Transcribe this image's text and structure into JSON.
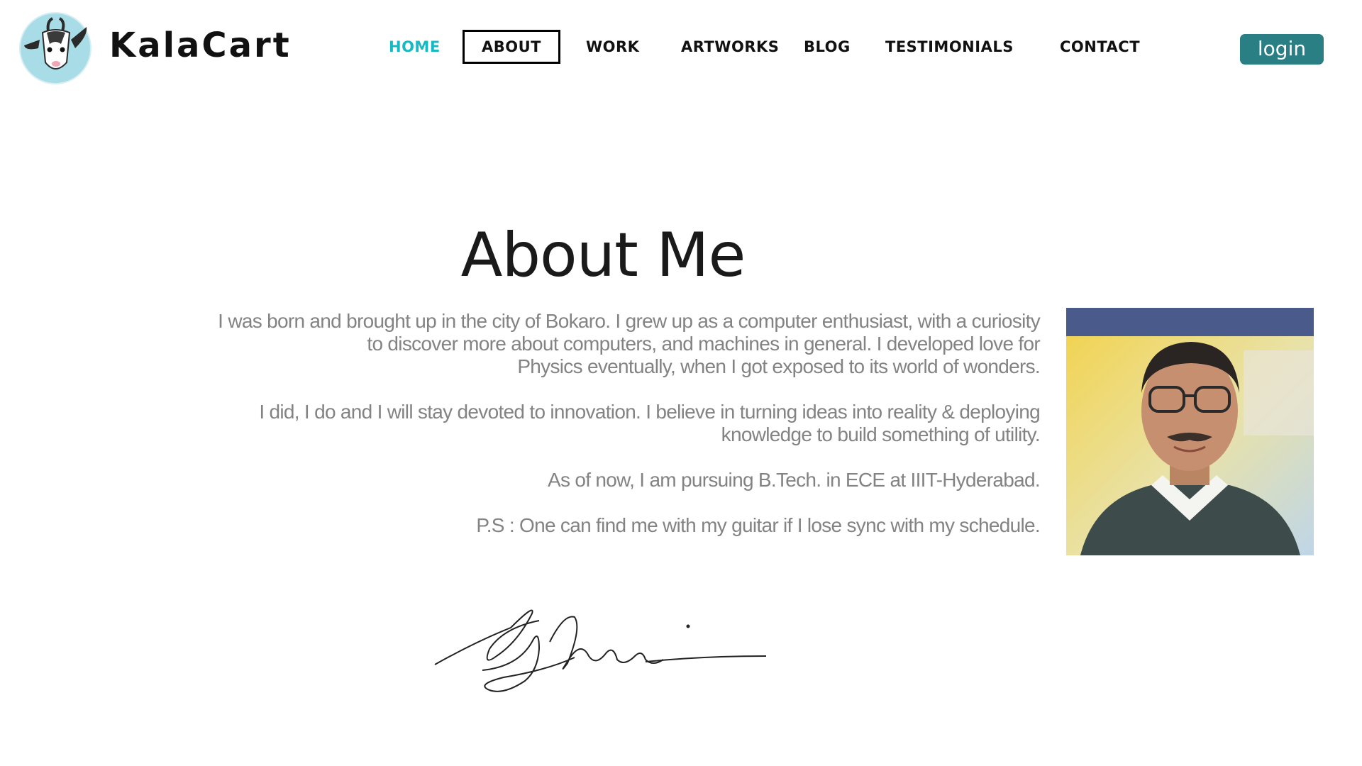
{
  "brand": {
    "name": "KalaCart"
  },
  "nav": {
    "items": [
      {
        "label": "HOME"
      },
      {
        "label": "ABOUT"
      },
      {
        "label": "WORK"
      },
      {
        "label": "ARTWORKS"
      },
      {
        "label": "BLOG"
      },
      {
        "label": "TESTIMONIALS"
      },
      {
        "label": "CONTACT"
      }
    ],
    "login_label": "login"
  },
  "about": {
    "title": "About Me",
    "paragraphs": [
      {
        "lines": [
          "I was born and brought up in the city of Bokaro. I grew up as a computer enthusiast, with a curiosity",
          "to discover more about computers, and machines in general. I developed love for",
          "Physics eventually, when I got exposed to its world of wonders."
        ]
      },
      {
        "lines": [
          "I did, I do and I will stay devoted to innovation. I believe in turning ideas into reality & deploying",
          "knowledge to build something of utility."
        ]
      },
      {
        "lines": [
          "As of now, I am pursuing B.Tech. in ECE at IIIT-Hyderabad."
        ]
      },
      {
        "lines": [
          "P.S : One can find me with my guitar if I lose sync with my schedule."
        ]
      }
    ]
  },
  "colors": {
    "accent_home": "#17b9c2",
    "login_bg": "#2a7f85",
    "body_text": "#838383",
    "title_text": "#1a1a1a"
  },
  "icons": {
    "logo": "goat-logo-icon"
  }
}
